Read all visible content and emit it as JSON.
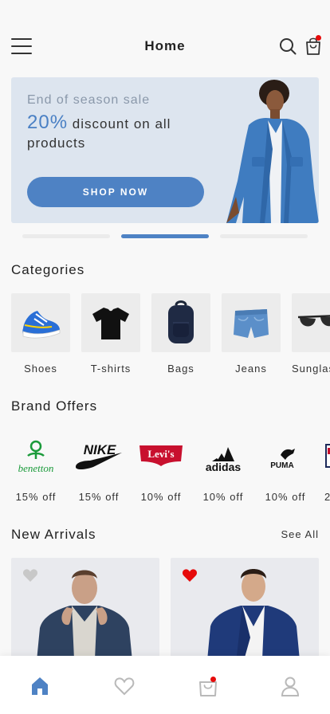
{
  "header": {
    "title": "Home",
    "icons": [
      "menu-icon",
      "search-icon",
      "cart-icon"
    ],
    "cart_has_notification": true
  },
  "banner": {
    "subtitle": "End of season sale",
    "percent": "20%",
    "headline_rest": "discount on all products",
    "cta": "SHOP NOW",
    "carousel_pages": 3,
    "carousel_active": 2
  },
  "categories": {
    "title": "Categories",
    "items": [
      {
        "label": "Shoes",
        "icon": "shoe-icon"
      },
      {
        "label": "T-shirts",
        "icon": "tshirt-icon"
      },
      {
        "label": "Bags",
        "icon": "backpack-icon"
      },
      {
        "label": "Jeans",
        "icon": "jeans-icon"
      },
      {
        "label": "Sunglasses",
        "icon": "sunglasses-icon"
      }
    ]
  },
  "brands": {
    "title": "Brand Offers",
    "items": [
      {
        "name": "benetton",
        "offer": "15% off"
      },
      {
        "name": "NIKE",
        "offer": "15% off"
      },
      {
        "name": "Levi's",
        "offer": "10% off"
      },
      {
        "name": "adidas",
        "offer": "10% off"
      },
      {
        "name": "PUMA",
        "offer": "10% off"
      },
      {
        "name": "",
        "offer": "2"
      }
    ]
  },
  "new_arrivals": {
    "title": "New Arrivals",
    "see_all": "See All",
    "items": [
      {
        "favorited": false
      },
      {
        "favorited": true
      }
    ]
  },
  "bottom_nav": {
    "items": [
      "home-icon",
      "heart-icon",
      "bag-icon",
      "profile-icon"
    ],
    "active": "home-icon"
  },
  "colors": {
    "accent": "#4e82c4",
    "notification": "#e60b0b",
    "banner_bg": "#dde5ef"
  }
}
